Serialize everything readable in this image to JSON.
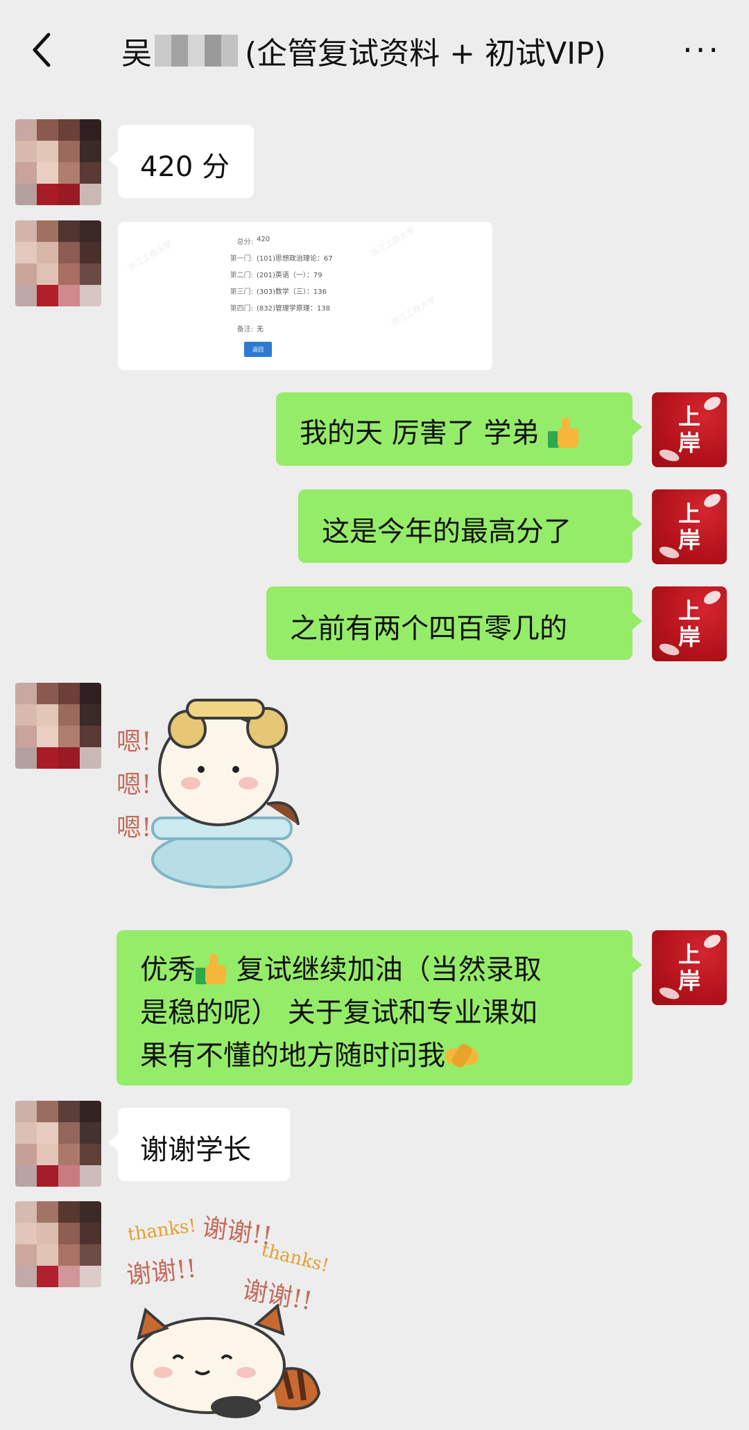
{
  "header": {
    "title_prefix": "吴",
    "title_suffix": "(企管复试资料 + 初试VIP)",
    "more_label": "···"
  },
  "self_avatar_text": "上岸",
  "messages": {
    "m1": "420 分",
    "m3": "我的天 厉害了 学弟",
    "m4": "这是今年的最高分了",
    "m5": "之前有两个四百零几的",
    "m7a": "优秀",
    "m7b": "复试继续加油（当然录取",
    "m7c": "是稳的呢） 关于复试和专业课如",
    "m7d": "果有不懂的地方随时问我",
    "m8": "谢谢学长"
  },
  "score_card": {
    "total_label": "总分:",
    "total_value": "420",
    "rows": [
      {
        "label": "第一门:",
        "value": "(101)思想政治理论：67"
      },
      {
        "label": "第二门:",
        "value": "(201)英语（一）：79"
      },
      {
        "label": "第三门:",
        "value": "(303)数学（三）：136"
      },
      {
        "label": "第四门:",
        "value": "(832)管理学原理：138"
      }
    ],
    "remark_label": "备注:",
    "remark_value": "无",
    "back_button": "返回",
    "watermark": "浙江工商大学"
  },
  "stickers": {
    "s1_text": "嗯!\n嗯!\n嗯!",
    "s2_thanks1": "thanks!",
    "s2_xiexie1": "谢谢!!",
    "s2_xiexie2": "谢谢!!",
    "s2_thanks2": "thanks!",
    "s2_xiexie3": "谢谢!!"
  },
  "colors": {
    "out_bubble": "#95ec69",
    "in_bubble": "#ffffff",
    "background": "#ededed",
    "self_avatar": "#b3121b"
  }
}
